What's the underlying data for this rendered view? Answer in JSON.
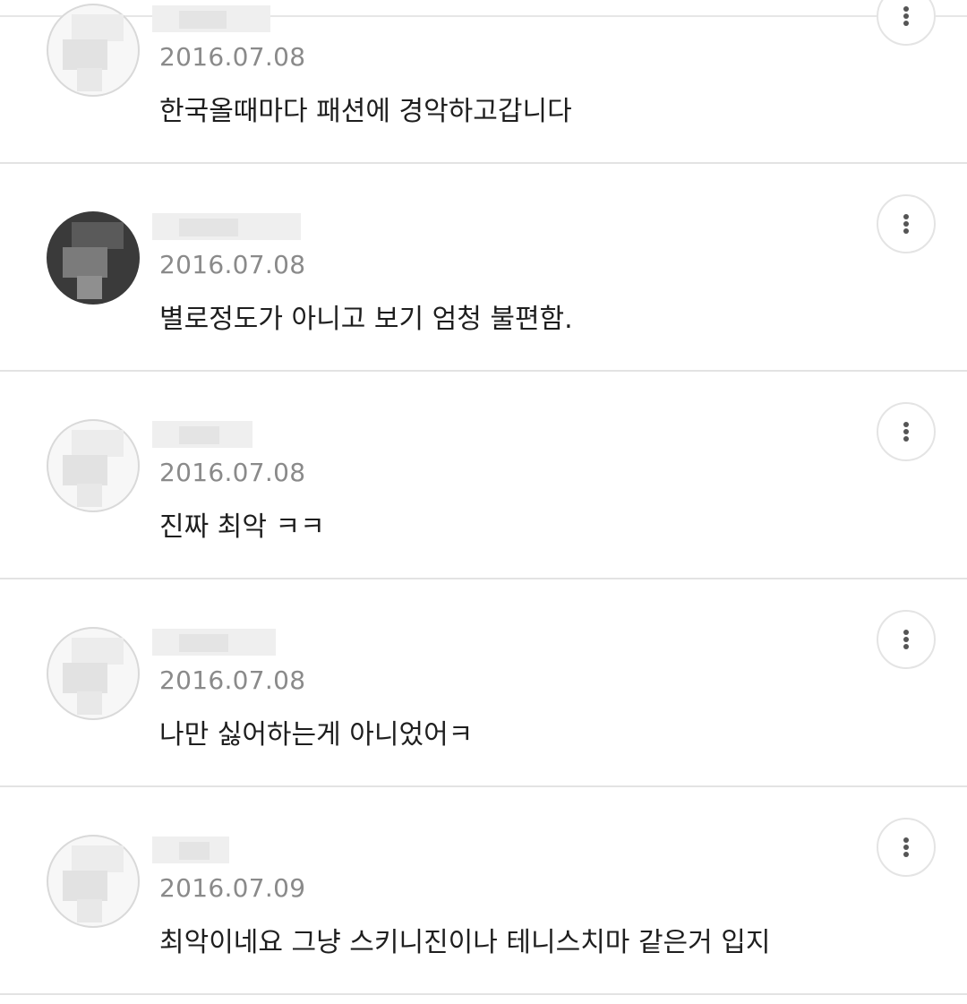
{
  "comments": [
    {
      "date": "2016.07.08",
      "text": "한국올때마다 패션에 경악하고갑니다",
      "avatar_icon": "user-avatar-icon",
      "menu_icon": "more-vertical-icon"
    },
    {
      "date": "2016.07.08",
      "text": "별로정도가 아니고 보기 엄청 불편함.",
      "avatar_icon": "user-avatar-icon",
      "menu_icon": "more-vertical-icon"
    },
    {
      "date": "2016.07.08",
      "text": "진짜 최악 ㅋㅋ",
      "avatar_icon": "user-avatar-icon",
      "menu_icon": "more-vertical-icon"
    },
    {
      "date": "2016.07.08",
      "text": "나만 싫어하는게 아니었어ㅋ",
      "avatar_icon": "user-avatar-icon",
      "menu_icon": "more-vertical-icon"
    },
    {
      "date": "2016.07.09",
      "text": "최악이네요 그냥 스키니진이나 테니스치마 같은거 입지",
      "avatar_icon": "user-avatar-icon",
      "menu_icon": "more-vertical-icon"
    }
  ],
  "colors": {
    "date_text": "#8a8a8a",
    "body_text": "#1e1e1e",
    "divider": "#e3e3e3"
  }
}
